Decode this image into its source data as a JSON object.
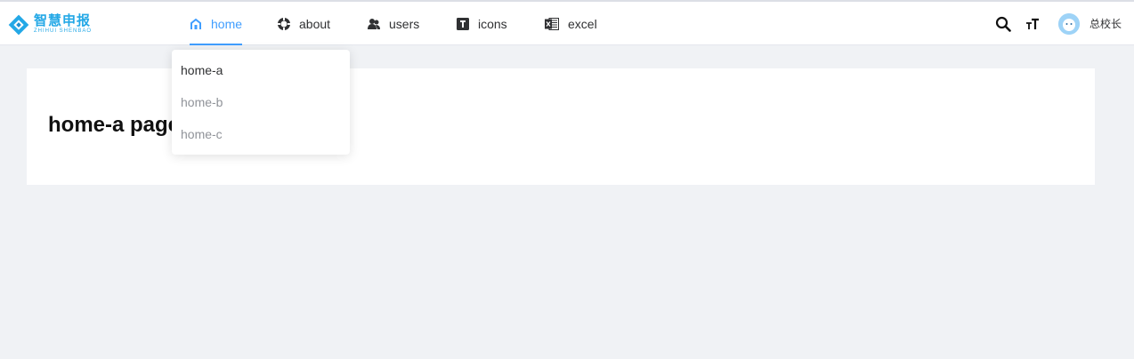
{
  "brand": {
    "name_cn": "智慧申报",
    "name_en": "ZHIHUI  SHENBAO"
  },
  "nav": {
    "items": [
      {
        "label": "home",
        "icon": "home-icon",
        "active": true
      },
      {
        "label": "about",
        "icon": "lifebuoy-icon"
      },
      {
        "label": "users",
        "icon": "users-icon"
      },
      {
        "label": "icons",
        "icon": "font-icon"
      },
      {
        "label": "excel",
        "icon": "excel-icon"
      }
    ]
  },
  "dropdown": {
    "items": [
      {
        "label": "home-a",
        "selected": true
      },
      {
        "label": "home-b"
      },
      {
        "label": "home-c"
      }
    ]
  },
  "toolbar": {
    "search_icon": "search-icon",
    "font_size_icon": "font-size-icon"
  },
  "user": {
    "name": "总校长",
    "avatar_icon": "avatar-icon"
  },
  "page": {
    "title": "home-a page"
  },
  "colors": {
    "accent": "#409eff",
    "logo": "#23a8e6",
    "background": "#f0f2f5"
  }
}
